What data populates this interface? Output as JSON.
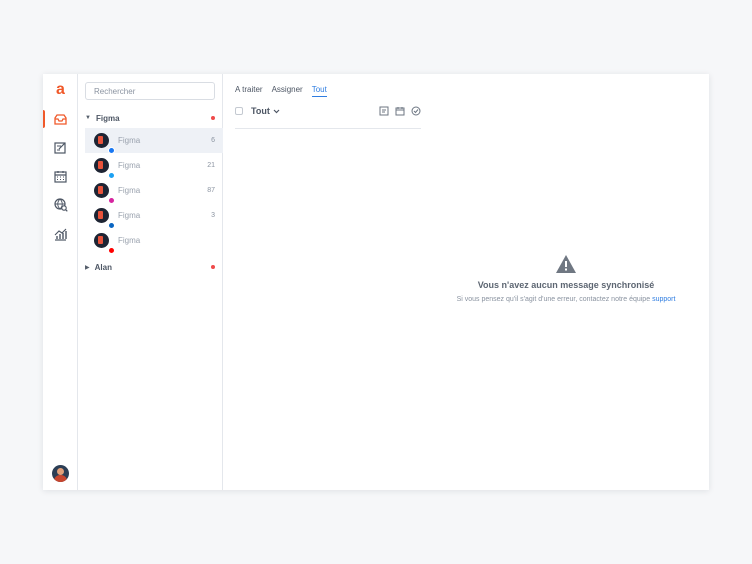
{
  "nav": {
    "brand": "a",
    "items": [
      {
        "icon": "inbox-icon",
        "active": true
      },
      {
        "icon": "compose-icon",
        "active": false
      },
      {
        "icon": "calendar-icon",
        "active": false
      },
      {
        "icon": "globe-search-icon",
        "active": false
      },
      {
        "icon": "analytics-icon",
        "active": false
      }
    ],
    "accent": "#f0592a"
  },
  "search": {
    "placeholder": "Rechercher"
  },
  "groups": [
    {
      "name": "Figma",
      "expanded": true,
      "unread": true
    },
    {
      "name": "Alan",
      "expanded": false,
      "unread": true
    }
  ],
  "accounts": [
    {
      "name": "Figma",
      "network": "facebook-icon",
      "color": "#1877f2",
      "count": "6",
      "selected": true
    },
    {
      "name": "Figma",
      "network": "twitter-icon",
      "color": "#1da1f2",
      "count": "21",
      "selected": false
    },
    {
      "name": "Figma",
      "network": "instagram-icon",
      "color": "#d6249f",
      "count": "87",
      "selected": false
    },
    {
      "name": "Figma",
      "network": "linkedin-icon",
      "color": "#0a66c2",
      "count": "3",
      "selected": false
    },
    {
      "name": "Figma",
      "network": "youtube-icon",
      "color": "#ff0000",
      "count": "",
      "selected": false
    }
  ],
  "tabs": [
    {
      "label": "A traiter",
      "active": false
    },
    {
      "label": "Assigner",
      "active": false
    },
    {
      "label": "Tout",
      "active": true
    }
  ],
  "toolbar": {
    "filter_label": "Tout"
  },
  "empty": {
    "title": "Vous n'avez aucun message synchronisé",
    "hint": "Si vous pensez qu'il s'agit d'une erreur, contactez notre équipe",
    "link": "support"
  }
}
